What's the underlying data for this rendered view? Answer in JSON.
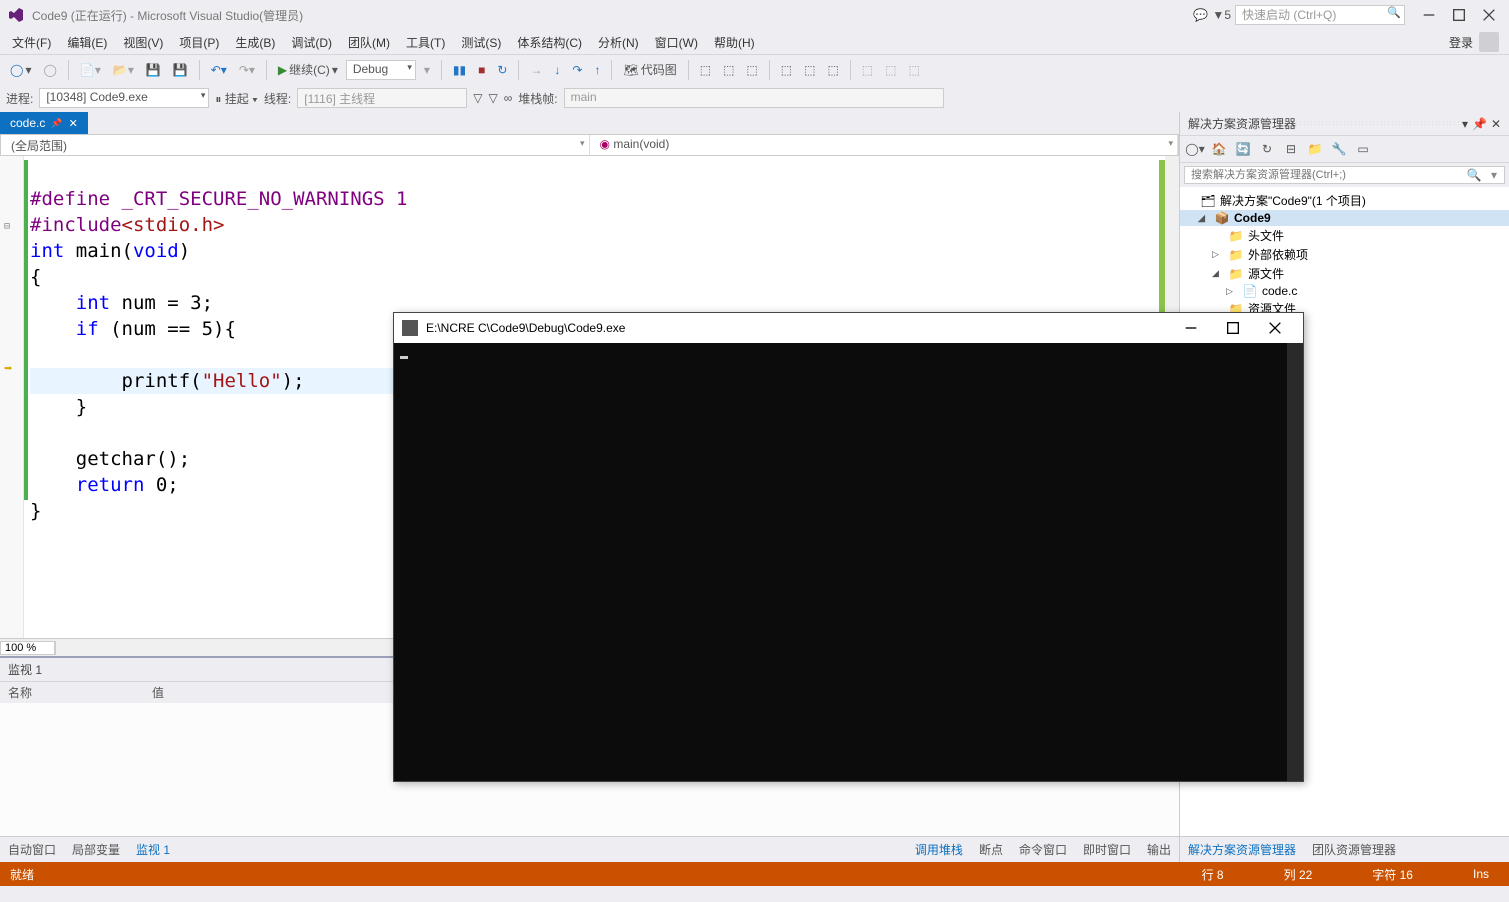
{
  "titlebar": {
    "title": "Code9 (正在运行) - Microsoft Visual Studio(管理员)",
    "flag_count": "5",
    "quick_launch_placeholder": "快速启动 (Ctrl+Q)"
  },
  "menubar": {
    "items": [
      "文件(F)",
      "编辑(E)",
      "视图(V)",
      "项目(P)",
      "生成(B)",
      "调试(D)",
      "团队(M)",
      "工具(T)",
      "测试(S)",
      "体系结构(C)",
      "分析(N)",
      "窗口(W)",
      "帮助(H)"
    ],
    "login": "登录"
  },
  "toolbar": {
    "continue_label": "继续(C)",
    "config": "Debug",
    "code_map": "代码图"
  },
  "debugbar": {
    "process_label": "进程:",
    "process_value": "[10348] Code9.exe",
    "suspend": "挂起",
    "thread_label": "线程:",
    "thread_value": "[1116] 主线程",
    "stack_label": "堆栈帧:",
    "stack_value": "main"
  },
  "doc_tab": {
    "name": "code.c"
  },
  "navbar": {
    "scope": "(全局范围)",
    "member": "main(void)"
  },
  "code": {
    "l1a": "#define",
    "l1b": " _CRT_SECURE_NO_WARNINGS 1",
    "l2a": "#include",
    "l2b": "<stdio.h>",
    "l3a": "int",
    "l3b": " main(",
    "l3c": "void",
    "l3d": ")",
    "l4": "{",
    "l5a": "    int",
    "l5b": " num = 3;",
    "l6a": "    if",
    "l6b": " (num == 5){",
    "l7a": "        printf(",
    "l7b": "\"Hello\"",
    "l7c": ");",
    "l8": "    }",
    "l9": "",
    "l10": "    getchar();",
    "l11a": "    return",
    "l11b": " 0;",
    "l12": "}"
  },
  "zoom": "100 %",
  "watch": {
    "title": "监视 1",
    "col_name": "名称",
    "col_value": "值",
    "tabs": [
      "自动窗口",
      "局部变量",
      "监视 1"
    ]
  },
  "center_tabs": [
    "调用堆栈",
    "断点",
    "命令窗口",
    "即时窗口",
    "输出"
  ],
  "solution": {
    "title": "解决方案资源管理器",
    "search_placeholder": "搜索解决方案资源管理器(Ctrl+;)",
    "root": "解决方案\"Code9\"(1 个项目)",
    "project": "Code9",
    "headers": "头文件",
    "external": "外部依赖项",
    "sources": "源文件",
    "file": "code.c",
    "resources": "资源文件",
    "bottom_tabs": [
      "解决方案资源管理器",
      "团队资源管理器"
    ]
  },
  "statusbar": {
    "ready": "就绪",
    "line": "行 8",
    "col": "列 22",
    "char": "字符 16",
    "ins": "Ins"
  },
  "console": {
    "title": "E:\\NCRE C\\Code9\\Debug\\Code9.exe"
  }
}
